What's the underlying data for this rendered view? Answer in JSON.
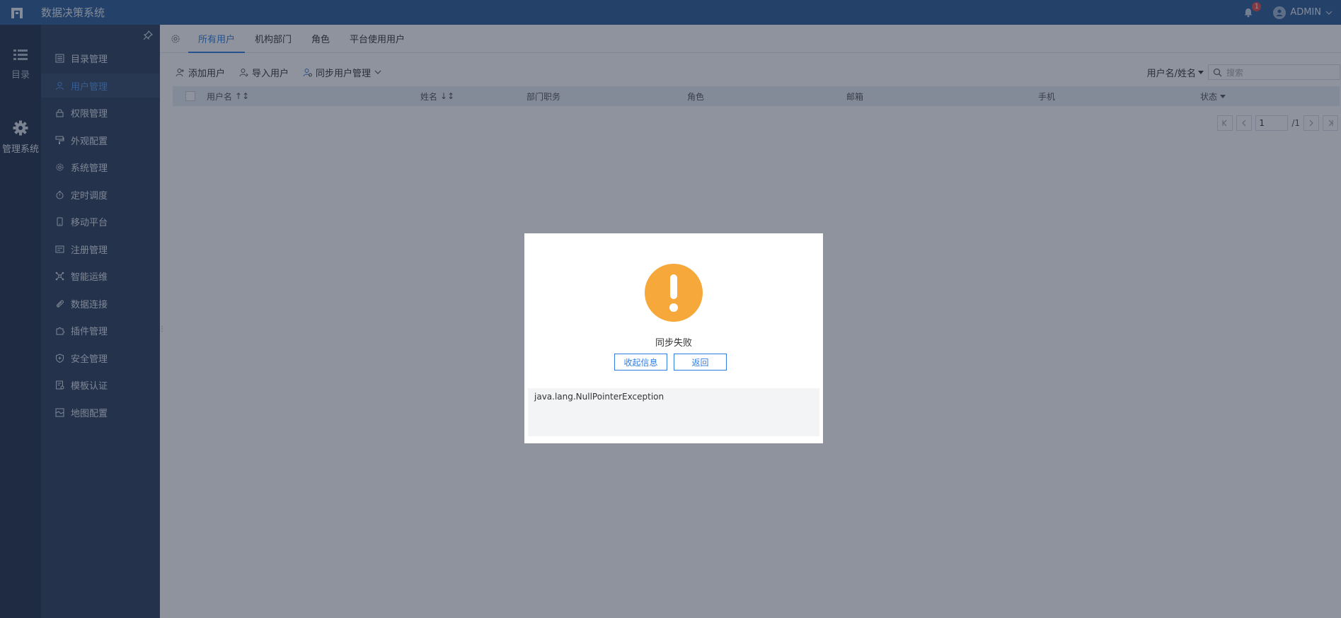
{
  "app": {
    "title": "数据决策系统",
    "notification_count": "1",
    "user_name": "ADMIN"
  },
  "rail": {
    "items": [
      {
        "label": "目录",
        "icon": "list-icon"
      },
      {
        "label": "管理系统",
        "icon": "gear-icon"
      }
    ]
  },
  "sidebar": {
    "items": [
      {
        "label": "目录管理",
        "icon": "catalog-icon"
      },
      {
        "label": "用户管理",
        "icon": "user-icon",
        "active": true
      },
      {
        "label": "权限管理",
        "icon": "lock-icon"
      },
      {
        "label": "外观配置",
        "icon": "paint-roller-icon"
      },
      {
        "label": "系统管理",
        "icon": "gear-icon"
      },
      {
        "label": "定时调度",
        "icon": "stopwatch-icon"
      },
      {
        "label": "移动平台",
        "icon": "mobile-icon"
      },
      {
        "label": "注册管理",
        "icon": "registration-icon"
      },
      {
        "label": "智能运维",
        "icon": "network-icon"
      },
      {
        "label": "数据连接",
        "icon": "paperclip-icon"
      },
      {
        "label": "插件管理",
        "icon": "puzzle-icon"
      },
      {
        "label": "安全管理",
        "icon": "shield-icon"
      },
      {
        "label": "模板认证",
        "icon": "template-cert-icon"
      },
      {
        "label": "地图配置",
        "icon": "map-icon"
      }
    ]
  },
  "tabs": [
    {
      "label": "所有用户",
      "active": true
    },
    {
      "label": "机构部门"
    },
    {
      "label": "角色"
    },
    {
      "label": "平台使用用户"
    }
  ],
  "toolbar": {
    "add_user": "添加用户",
    "import_user": "导入用户",
    "sync_user": "同步用户管理",
    "filter_select": "用户名/姓名",
    "search_placeholder": "搜索"
  },
  "table": {
    "columns": [
      "用户名",
      "姓名",
      "部门职务",
      "角色",
      "邮箱",
      "手机",
      "状态"
    ]
  },
  "pager": {
    "current_page": "1",
    "total_pages": "/1"
  },
  "dialog": {
    "title": "同步失败",
    "collapse_label": "收起信息",
    "back_label": "返回",
    "detail": "java.lang.NullPointerException"
  },
  "colors": {
    "topbar": "#2a5a98",
    "rail": "#1e2f49",
    "sidebar": "#2a3c5a",
    "accent": "#2f7de1",
    "warning": "#f6a83a"
  }
}
